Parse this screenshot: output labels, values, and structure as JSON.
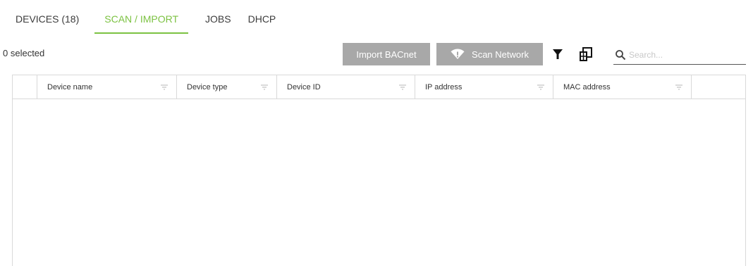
{
  "tabs": [
    {
      "label": "DEVICES (18)",
      "active": false
    },
    {
      "label": "SCAN / IMPORT",
      "active": true
    },
    {
      "label": "JOBS",
      "active": false
    },
    {
      "label": "DHCP",
      "active": false
    }
  ],
  "toolbar": {
    "selected_text": "0 selected",
    "import_label": "Import BACnet",
    "scan_label": "Scan Network",
    "search_placeholder": "Search...",
    "search_value": ""
  },
  "table": {
    "columns": [
      {
        "label": ""
      },
      {
        "label": "Device name"
      },
      {
        "label": "Device type"
      },
      {
        "label": "Device ID"
      },
      {
        "label": "IP address"
      },
      {
        "label": "MAC address"
      },
      {
        "label": ""
      }
    ],
    "rows": []
  },
  "icons": {
    "scan": "wifi-icon",
    "filter": "filter-icon",
    "columns": "column-chooser-icon",
    "search": "search-icon",
    "sort": "sort-lines-icon"
  },
  "colors": {
    "accent": "#7cc242",
    "button_bg": "#a8a8a8",
    "border": "#d9d9d9"
  }
}
